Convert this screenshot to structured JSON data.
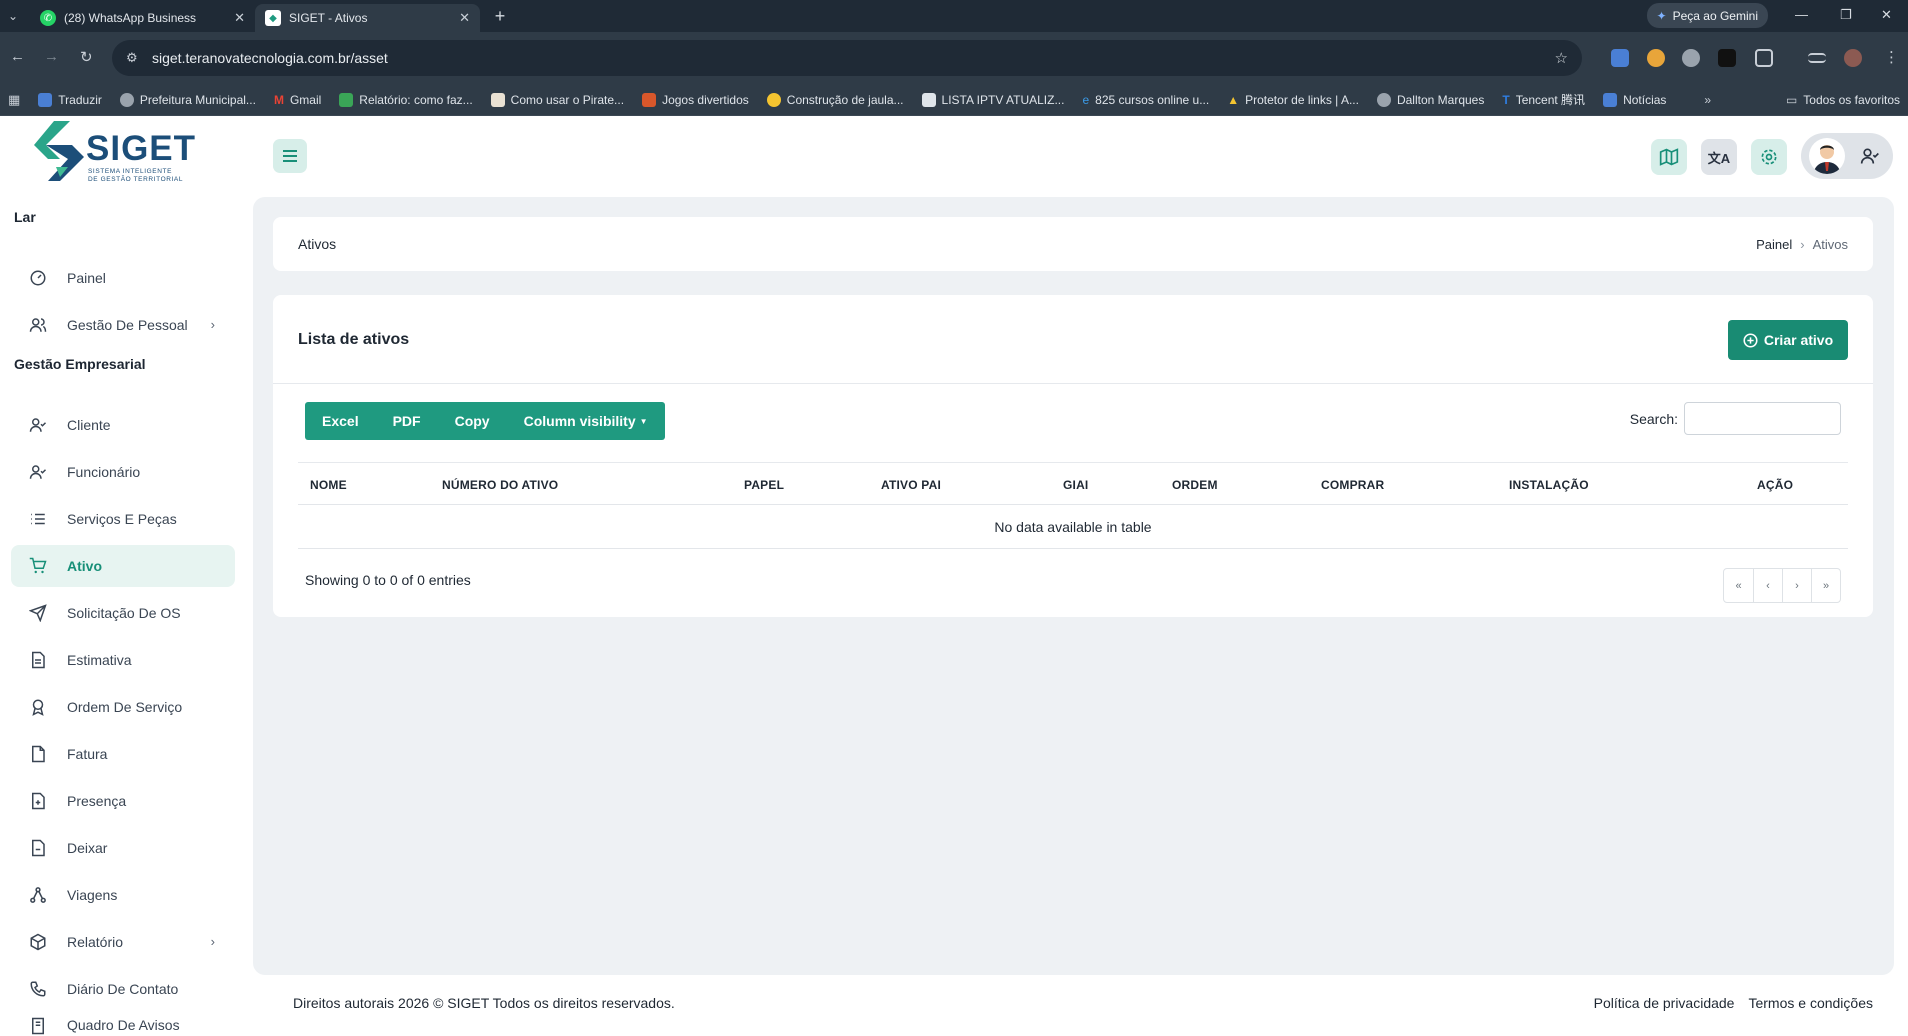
{
  "browser": {
    "tabs": [
      {
        "title": "(28) WhatsApp Business"
      },
      {
        "title": "SIGET - Ativos"
      }
    ],
    "gemini_label": "Peça ao Gemini",
    "url": "siget.teranovatecnologia.com.br/asset",
    "bookmarks": [
      "Traduzir",
      "Prefeitura Municipal...",
      "Gmail",
      "Relatório: como faz...",
      "Como usar o Pirate...",
      "Jogos divertidos",
      "Construção de jaula...",
      "LISTA IPTV ATUALIZ...",
      "825 cursos online u...",
      "Protetor de links | A...",
      "Dallton Marques",
      "Tencent 腾讯",
      "Notícias"
    ],
    "all_bookmarks": "Todos os favoritos",
    "colors": {
      "chrome_dark": "#1f2a36",
      "chrome": "#2f3b47"
    }
  },
  "sidebar": {
    "logo_text": "SIGET",
    "logo_tagline_1": "SISTEMA INTELIGENTE",
    "logo_tagline_2": "DE GESTÃO TERRITORIAL",
    "sections": [
      {
        "caption": "Lar"
      },
      {
        "caption": "Gestão Empresarial"
      }
    ],
    "items": [
      {
        "label": "Painel",
        "icon": "dashboard-icon"
      },
      {
        "label": "Gestão De Pessoal",
        "icon": "users-icon"
      },
      {
        "label": "Cliente",
        "icon": "user-check-icon"
      },
      {
        "label": "Funcionário",
        "icon": "user-check-icon"
      },
      {
        "label": "Serviços E Peças",
        "icon": "list-icon"
      },
      {
        "label": "Ativo",
        "icon": "cart-icon"
      },
      {
        "label": "Solicitação De OS",
        "icon": "send-icon"
      },
      {
        "label": "Estimativa",
        "icon": "file-text-icon"
      },
      {
        "label": "Ordem De Serviço",
        "icon": "award-icon"
      },
      {
        "label": "Fatura",
        "icon": "file-icon"
      },
      {
        "label": "Presença",
        "icon": "file-plus-icon"
      },
      {
        "label": "Deixar",
        "icon": "file-minus-icon"
      },
      {
        "label": "Viagens",
        "icon": "share-icon"
      },
      {
        "label": "Relatório",
        "icon": "box-icon"
      },
      {
        "label": "Diário De Contato",
        "icon": "phone-icon"
      },
      {
        "label": "Quadro De Avisos",
        "icon": "notebook-icon"
      }
    ],
    "accent": "#178f78",
    "active_bg": "#e7f4f1"
  },
  "header": {
    "title": "Ativos",
    "breadcrumb": [
      "Painel",
      "Ativos"
    ]
  },
  "card": {
    "title": "Lista de ativos",
    "create_button": "Criar ativo",
    "export_buttons": [
      "Excel",
      "PDF",
      "Copy",
      "Column visibility"
    ],
    "search_label": "Search:",
    "columns": [
      "NOME",
      "NÚMERO DO ATIVO",
      "PAPEL",
      "ATIVO PAI",
      "GIAI",
      "ORDEM",
      "COMPRAR",
      "INSTALAÇÃO",
      "AÇÃO"
    ],
    "empty_message": "No data available in table",
    "info": "Showing 0 to 0 of 0 entries",
    "pager": [
      "«",
      "‹",
      "›",
      "»"
    ],
    "button_color": "#198b73"
  },
  "footer": {
    "copyright": "Direitos autorais 2026 © SIGET Todos os direitos reservados.",
    "privacy": "Política de privacidade",
    "terms": "Termos e condições"
  }
}
